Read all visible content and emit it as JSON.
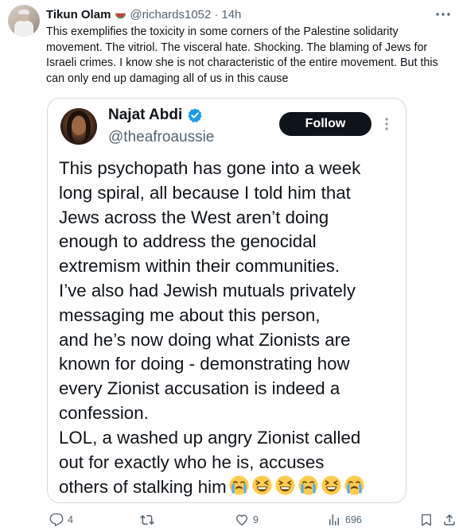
{
  "tweet": {
    "author_name": "Tikun Olam",
    "author_emoji": "watermelon",
    "handle": "@richards1052",
    "separator": "·",
    "time": "14h",
    "text": "This exemplifies the toxicity in some corners of the Palestine solidarity movement. The vitriol. The visceral hate. Shocking. The blaming of Jews for Israeli crimes. I know she is not characteristic of the entire movement. But this can only end up damaging all of us in this cause"
  },
  "quoted": {
    "name": "Najat Abdi",
    "handle": "@theafroaussie",
    "follow_label": "Follow",
    "lines": [
      "This psychopath has gone into a week",
      "long spiral, all because I told him that",
      "Jews across the West aren’t doing",
      "enough to address the genocidal",
      "extremism within their communities.",
      "I’ve also had Jewish mutuals privately",
      "messaging me about this person,",
      "and he’s now doing what Zionists are",
      "known for doing - demonstrating how",
      "every Zionist accusation is indeed a",
      "confession.",
      "LOL, a washed up angry Zionist called",
      "out for exactly who he is, accuses",
      "others of stalking him"
    ],
    "emojis": [
      "loudly-crying-face",
      "grinning-squinting-face",
      "grinning-squinting-face",
      "loudly-crying-face",
      "grinning-squinting-face",
      "loudly-crying-face"
    ]
  },
  "actions": {
    "replies": "4",
    "retweets": "",
    "likes": "9",
    "views": "696"
  },
  "colors": {
    "text": "#0f1419",
    "muted": "#536471",
    "border": "#cfd9de",
    "verified": "#1d9bf0",
    "follow_bg": "#0f1419"
  }
}
